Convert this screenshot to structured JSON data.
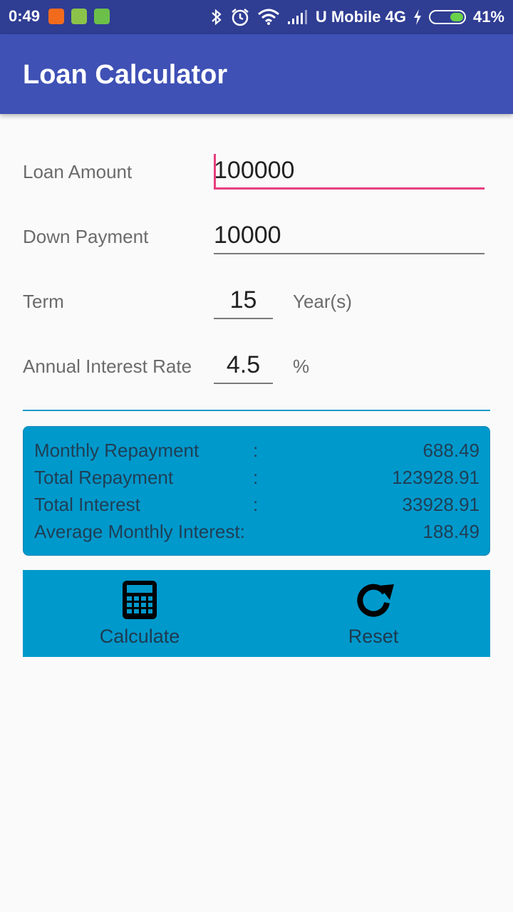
{
  "status_bar": {
    "time": "0:49",
    "carrier": "U Mobile 4G",
    "battery": "41%",
    "battery_level": 0.41
  },
  "app": {
    "title": "Loan Calculator"
  },
  "form": {
    "loan_amount": {
      "label": "Loan Amount",
      "value": "100000"
    },
    "down_payment": {
      "label": "Down Payment",
      "value": "10000"
    },
    "term": {
      "label": "Term",
      "value": "15",
      "unit": "Year(s)"
    },
    "interest_rate": {
      "label": "Annual Interest Rate",
      "value": "4.5",
      "unit": "%"
    }
  },
  "results": {
    "monthly_repayment": {
      "label": "Monthly Repayment",
      "colon": ":",
      "value": "688.49"
    },
    "total_repayment": {
      "label": "Total Repayment",
      "colon": ":",
      "value": "123928.91"
    },
    "total_interest": {
      "label": "Total Interest",
      "colon": ":",
      "value": "33928.91"
    },
    "avg_monthly_interest": {
      "label": "Average Monthly Interest:",
      "value": "188.49"
    }
  },
  "buttons": {
    "calculate": {
      "label": "Calculate",
      "icon": "calculator-icon"
    },
    "reset": {
      "label": "Reset",
      "icon": "refresh-icon"
    }
  },
  "colors": {
    "app_bar": "#3f51b5",
    "status_bar": "#2f3d93",
    "accent": "#e73e7d",
    "panel": "#0099cc"
  }
}
